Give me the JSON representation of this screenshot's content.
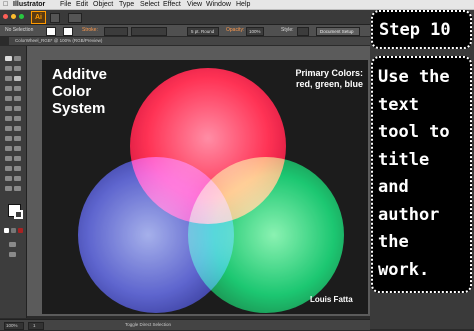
{
  "menubar": {
    "items": [
      "Illustrator",
      "File",
      "Edit",
      "Object",
      "Type",
      "Select",
      "Effect",
      "View",
      "Window",
      "Help"
    ]
  },
  "appbar": {
    "logo": "Ai"
  },
  "control_bar": {
    "selection_label": "No Selection",
    "stroke_label": "Stroke:",
    "brush_value": "5 pt. Round",
    "opacity_label": "Opacity:",
    "opacity_value": "100%",
    "style_label": "Style:",
    "doc_setup_label": "Document Setup"
  },
  "document_tab": {
    "title": "ColorWheel_RGB* @ 100% (RGB/Preview)"
  },
  "artboard": {
    "title_lines": [
      "Additve",
      "Color",
      "System"
    ],
    "subtitle_lines": [
      "Primary Colors:",
      "red, green, blue"
    ],
    "author": "Louis Fatta",
    "colors": {
      "red": "#ff1a40",
      "green": "#00c060",
      "blue": "#4a52c8",
      "background": "#1c1c1c"
    }
  },
  "status_bar": {
    "zoom": "100%",
    "page": "1",
    "mode": "Toggle Direct Selection"
  },
  "overlay": {
    "step": "Step 10",
    "instruction_lines": [
      "Use the",
      "text",
      "tool to",
      "title",
      "and",
      "author",
      "the",
      "work."
    ]
  }
}
